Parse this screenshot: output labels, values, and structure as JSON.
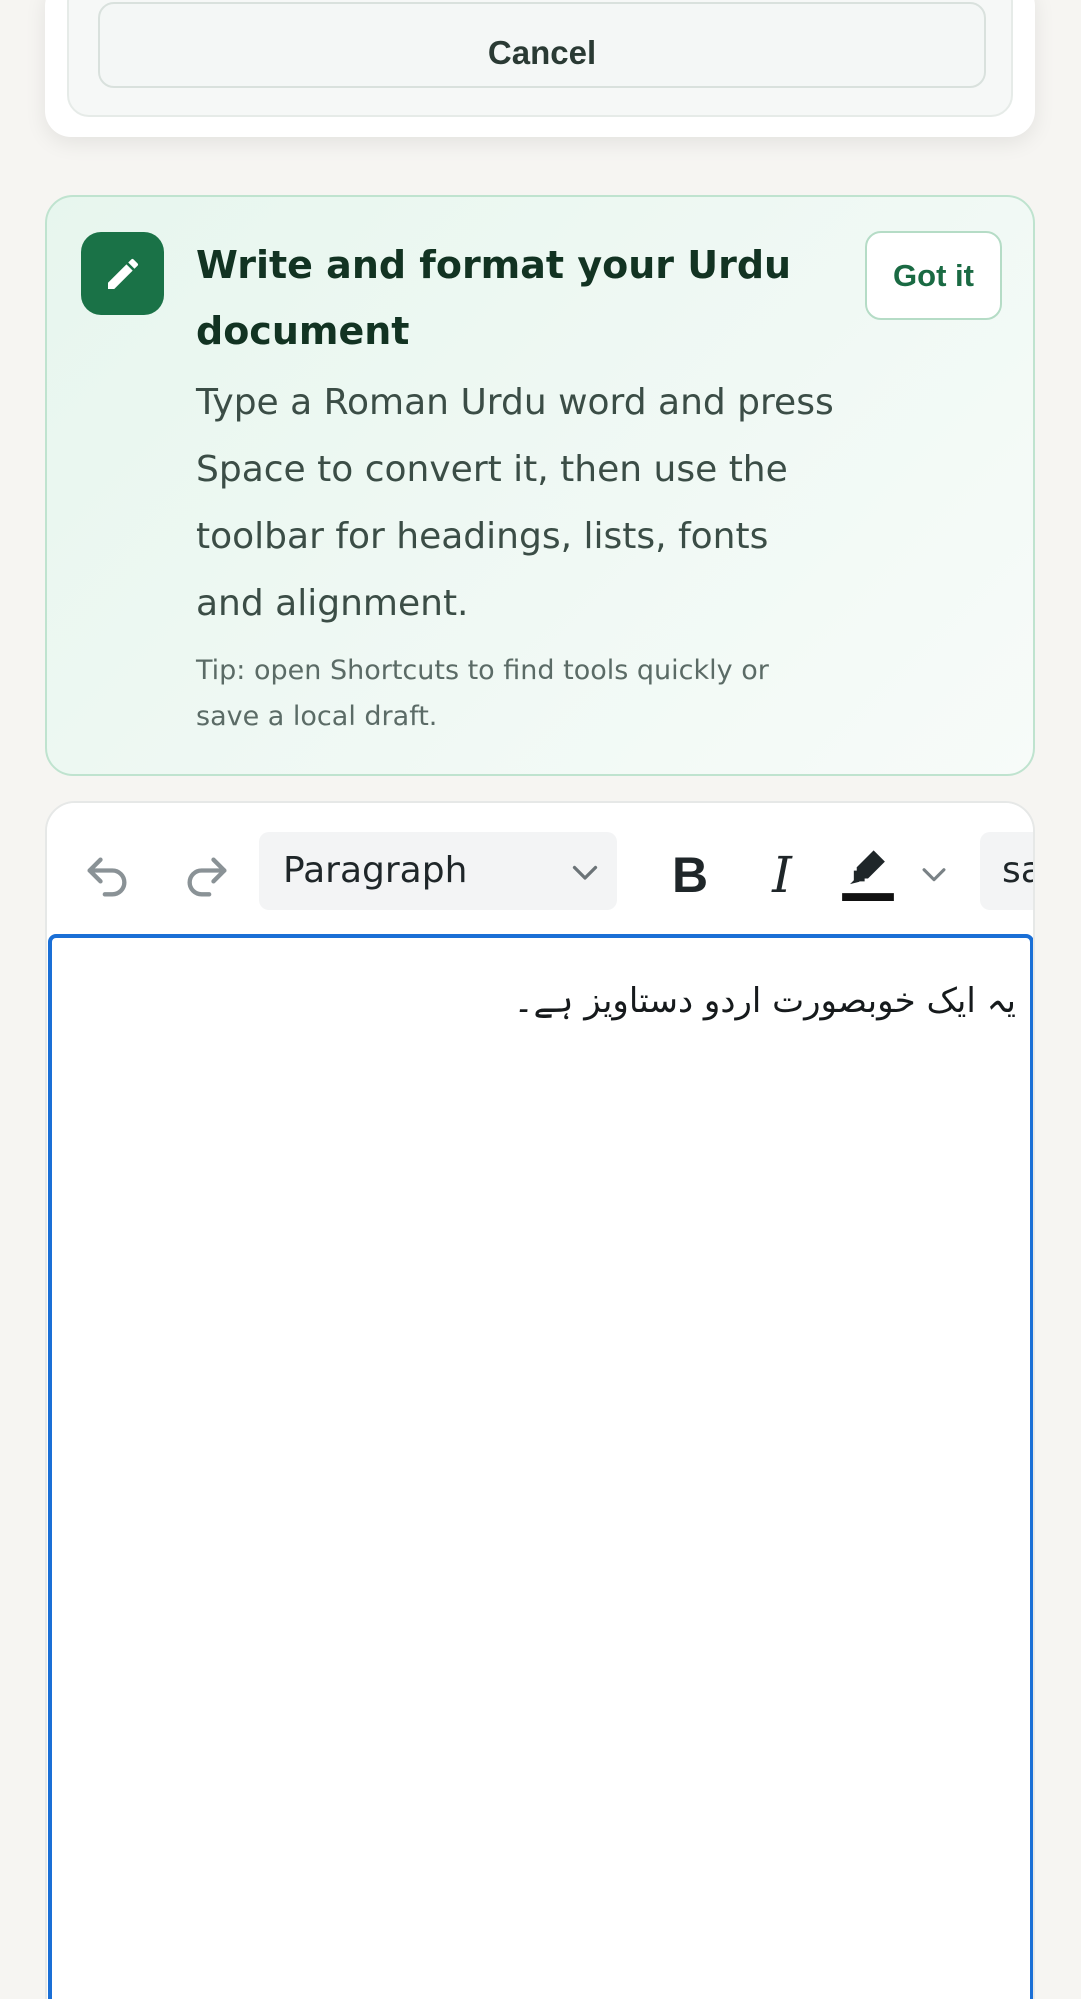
{
  "top_card": {
    "cancel_label": "Cancel"
  },
  "banner": {
    "icon": "pencil-icon",
    "title": "Write and format your Urdu document",
    "body": "Type a Roman Urdu word and press Space to convert it, then use the toolbar for headings, lists, fonts and alignment.",
    "tip": "Tip: open Shortcuts to find tools quickly or save a local draft.",
    "dismiss_label": "Got it",
    "colors": {
      "icon_bg": "#1a7247",
      "border": "#bfe3cf",
      "title": "#123322"
    }
  },
  "toolbar": {
    "undo_icon": "undo-icon",
    "redo_icon": "redo-icon",
    "block_type": "Paragraph",
    "bold_label": "B",
    "italic_label": "I",
    "highlight_icon": "highlighter-icon",
    "font_family_visible": "sa"
  },
  "editor": {
    "content": "یہ ایک خوبصورت اردو دستاویز ہے۔",
    "focus_color": "#1a6fd6"
  }
}
